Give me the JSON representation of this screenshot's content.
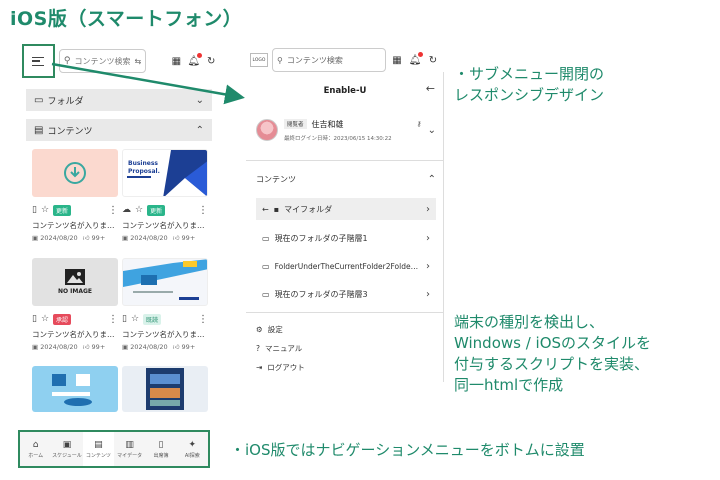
{
  "page_title": "iOS版（スマートフォン）",
  "left_phone": {
    "search_placeholder": "コンテンツ検索",
    "sections": [
      {
        "label": "フォルダ",
        "chevron": "⌄"
      },
      {
        "label": "コンテンツ",
        "chevron": "⌃"
      }
    ],
    "cards": [
      {
        "tag": "更新",
        "tag_style": "green",
        "title": "コンテンツ名が入りま…",
        "date": "2024/08/20",
        "likes": "99+"
      },
      {
        "tag": "更新",
        "tag_style": "green",
        "title": "コンテンツ名が入りま…",
        "date": "2024/08/20",
        "likes": "99+",
        "thumb_text_1": "Business",
        "thumb_text_2": "Proposal."
      },
      {
        "tag": "承認",
        "tag_style": "red",
        "title": "コンテンツ名が入りま…",
        "date": "2024/08/20",
        "likes": "99+",
        "thumb_text_1": "NO IMAGE"
      },
      {
        "tag": "既読",
        "tag_style": "mint",
        "title": "コンテンツ名が入りま…",
        "date": "2024/08/20",
        "likes": "99+"
      }
    ],
    "bottom_nav": [
      {
        "label": "ホーム",
        "icon": "home-icon"
      },
      {
        "label": "スケジュール",
        "icon": "calendar-icon"
      },
      {
        "label": "コンテンツ",
        "icon": "document-icon",
        "active": true
      },
      {
        "label": "マイデータ",
        "icon": "mydata-icon"
      },
      {
        "label": "出席簿",
        "icon": "attendance-icon"
      },
      {
        "label": "AI探索",
        "icon": "sparkle-icon"
      }
    ]
  },
  "right_phone": {
    "logo": "LOGO",
    "search_placeholder": "コンテンツ検索",
    "drawer_title": "Enable-U",
    "user": {
      "role": "閲覧者",
      "name": "住吉和雄",
      "last_login": "最終ログイン日時：2023/06/15 14:30:22"
    },
    "contents_label": "コンテンツ",
    "folders": [
      {
        "label": "マイフォルダ"
      },
      {
        "label": "現在のフォルダの子階層1"
      },
      {
        "label": "FolderUnderTheCurrentFolder2Folde…"
      },
      {
        "label": "現在のフォルダの子階層3"
      }
    ],
    "footer_menu": [
      {
        "label": "設定",
        "icon": "gear-icon"
      },
      {
        "label": "マニュアル",
        "icon": "help-icon"
      },
      {
        "label": "ログアウト",
        "icon": "logout-icon"
      }
    ]
  },
  "annotations": {
    "submenu_1": "・サブメニュー開閉の",
    "submenu_2": "レスポンシブデザイン",
    "detect_1": "端末の種別を検出し、",
    "detect_2": "Windows / iOSのスタイルを",
    "detect_3": "付与するスクリプトを実装、",
    "detect_4": "同一htmlで作成",
    "bottom_nav_note": "・iOS版ではナビゲーションメニューをボトムに設置"
  },
  "colors": {
    "accent": "#1f8a6b",
    "frame": "#2f8a5f"
  }
}
